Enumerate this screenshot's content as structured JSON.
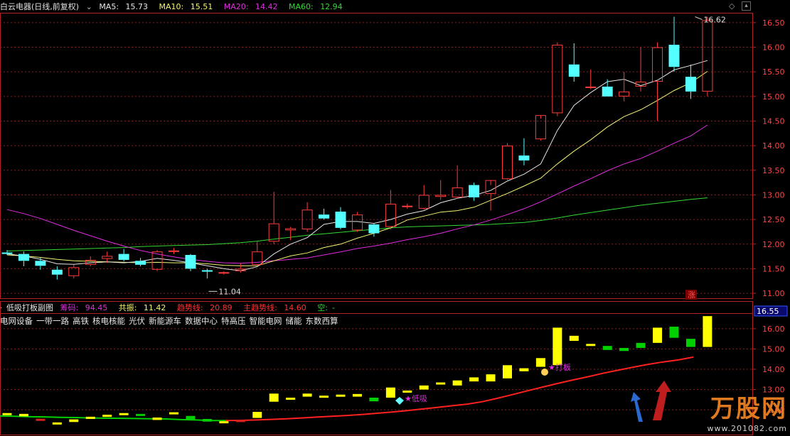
{
  "header": {
    "title": "白云电器(日线,前复权)",
    "ma5_label": "MA5: ",
    "ma5_value": "15.73",
    "ma10_label": "MA10: ",
    "ma10_value": "15.51",
    "ma20_label": "MA20: ",
    "ma20_value": "14.42",
    "ma60_label": "MA60: ",
    "ma60_value": "12.94"
  },
  "indicator": {
    "name": "低吸打板副图",
    "chip_label": "筹码: ",
    "chip_value": "94.45",
    "resonance_label": "共振: ",
    "resonance_value": "11.42",
    "trend_label": "趋势线: ",
    "trend_value": "20.89",
    "main_trend_label": "主趋势线: ",
    "main_trend_value": "14.60",
    "empty_label": "空:",
    "empty_value": "-"
  },
  "sectors": [
    "电网设备",
    "一带一路",
    "高铁",
    "核电核能",
    "光伏",
    "新能源车",
    "数据中心",
    "特高压",
    "智能电网",
    "储能",
    "东数西算"
  ],
  "watermark": {
    "brand": "万股网",
    "url": "www.201082.com"
  },
  "annotations": {
    "high_label": "16.62",
    "low_label": "11.04",
    "limit_up_badge": "涨",
    "dip_label": "低吸",
    "board_label": "打板",
    "current_price_tag": "16.55"
  },
  "colors": {
    "up": "#ff3c3c",
    "down": "#54ffff",
    "ma5": "#e6e6e6",
    "ma10": "#f4f473",
    "ma20": "#e02de0",
    "ma60": "#33d933",
    "grid": "#8a1f1f",
    "axis": "#b22222",
    "ind_bar": "#ffff00",
    "ind_green": "#00d000",
    "trend": "#ff2020"
  },
  "chart_data": [
    {
      "type": "candlestick",
      "title": "白云电器(日线,前复权)",
      "y_ticks_upper": [
        "16.50",
        "16.00",
        "15.50",
        "15.00",
        "14.50",
        "14.00",
        "13.50",
        "13.00",
        "12.50",
        "12.00",
        "11.50",
        "11.00"
      ],
      "ylim": [
        10.9,
        16.7
      ],
      "ohlc": [
        [
          11.83,
          11.88,
          11.78,
          11.8
        ],
        [
          11.8,
          11.85,
          11.55,
          11.66
        ],
        [
          11.66,
          11.72,
          11.48,
          11.56
        ],
        [
          11.48,
          11.55,
          11.28,
          11.38
        ],
        [
          11.35,
          11.58,
          11.3,
          11.53
        ],
        [
          11.58,
          11.75,
          11.55,
          11.68
        ],
        [
          11.7,
          11.85,
          11.62,
          11.76
        ],
        [
          11.8,
          11.9,
          11.65,
          11.68
        ],
        [
          11.66,
          11.72,
          11.55,
          11.58
        ],
        [
          11.48,
          11.88,
          11.45,
          11.85
        ],
        [
          11.85,
          11.92,
          11.8,
          11.87
        ],
        [
          11.78,
          11.8,
          11.45,
          11.5
        ],
        [
          11.47,
          11.5,
          11.3,
          11.44
        ],
        [
          11.42,
          11.45,
          11.38,
          11.43
        ],
        [
          11.45,
          11.62,
          11.42,
          11.5
        ],
        [
          11.58,
          12.05,
          11.55,
          11.85
        ],
        [
          12.05,
          13.06,
          12.0,
          12.42
        ],
        [
          12.28,
          12.35,
          12.08,
          12.32
        ],
        [
          12.3,
          12.85,
          12.25,
          12.7
        ],
        [
          12.6,
          12.72,
          12.5,
          12.52
        ],
        [
          12.66,
          12.75,
          12.3,
          12.33
        ],
        [
          12.28,
          12.65,
          12.25,
          12.6
        ],
        [
          12.4,
          12.42,
          12.15,
          12.22
        ],
        [
          12.35,
          13.1,
          12.3,
          12.82
        ],
        [
          12.78,
          12.82,
          12.72,
          12.78
        ],
        [
          12.72,
          13.2,
          12.7,
          13.0
        ],
        [
          12.96,
          13.3,
          12.9,
          13.0
        ],
        [
          12.95,
          13.6,
          12.92,
          13.15
        ],
        [
          13.2,
          13.25,
          12.88,
          12.95
        ],
        [
          13.02,
          13.2,
          12.68,
          13.3
        ],
        [
          13.32,
          14.05,
          13.3,
          14.0
        ],
        [
          13.8,
          14.15,
          13.6,
          13.7
        ],
        [
          14.13,
          14.55,
          14.1,
          14.62
        ],
        [
          14.66,
          16.1,
          14.6,
          16.05
        ],
        [
          15.65,
          16.08,
          15.3,
          15.4
        ],
        [
          15.2,
          15.55,
          15.15,
          15.2
        ],
        [
          15.2,
          15.35,
          15.0,
          15.0
        ],
        [
          15.0,
          15.5,
          14.9,
          15.1
        ],
        [
          15.2,
          16.0,
          15.1,
          15.3
        ],
        [
          15.3,
          16.1,
          14.5,
          16.0
        ],
        [
          16.05,
          16.62,
          15.5,
          15.6
        ],
        [
          15.4,
          15.65,
          14.95,
          15.1
        ],
        [
          15.1,
          16.62,
          15.0,
          16.55
        ]
      ],
      "ma5": [
        11.8,
        11.76,
        11.69,
        11.6,
        11.59,
        11.62,
        11.64,
        11.62,
        11.65,
        11.71,
        11.67,
        11.62,
        11.56,
        11.5,
        11.46,
        11.54,
        11.8,
        12.0,
        12.13,
        12.4,
        12.46,
        12.46,
        12.42,
        12.5,
        12.61,
        12.68,
        12.84,
        12.93,
        12.99,
        13.09,
        13.28,
        13.42,
        13.63,
        14.31,
        14.82,
        15.08,
        15.3,
        15.35,
        15.22,
        15.33,
        15.54,
        15.63,
        15.73
      ],
      "ma10": [
        11.78,
        11.76,
        11.73,
        11.69,
        11.66,
        11.65,
        11.64,
        11.63,
        11.62,
        11.63,
        11.62,
        11.62,
        11.6,
        11.57,
        11.56,
        11.56,
        11.66,
        11.76,
        11.82,
        11.93,
        12.0,
        12.12,
        12.22,
        12.33,
        12.49,
        12.57,
        12.65,
        12.68,
        12.75,
        12.89,
        13.03,
        13.18,
        13.34,
        13.63,
        13.89,
        14.12,
        14.38,
        14.59,
        14.73,
        14.92,
        15.12,
        15.28,
        15.51
      ],
      "ma20": [
        12.7,
        12.62,
        12.52,
        12.4,
        12.28,
        12.17,
        12.06,
        11.96,
        11.87,
        11.8,
        11.74,
        11.69,
        11.65,
        11.62,
        11.61,
        11.63,
        11.66,
        11.69,
        11.72,
        11.78,
        11.84,
        11.91,
        11.96,
        12.02,
        12.09,
        12.15,
        12.22,
        12.31,
        12.39,
        12.49,
        12.6,
        12.72,
        12.86,
        13.02,
        13.18,
        13.33,
        13.49,
        13.63,
        13.74,
        13.89,
        14.05,
        14.2,
        14.42
      ],
      "ma60": [
        11.86,
        11.87,
        11.88,
        11.89,
        11.9,
        11.91,
        11.92,
        11.93,
        11.95,
        11.96,
        11.97,
        11.98,
        11.99,
        12.01,
        12.03,
        12.06,
        12.1,
        12.14,
        12.18,
        12.21,
        12.24,
        12.27,
        12.3,
        12.33,
        12.35,
        12.36,
        12.37,
        12.38,
        12.39,
        12.4,
        12.42,
        12.44,
        12.48,
        12.53,
        12.59,
        12.64,
        12.69,
        12.74,
        12.79,
        12.83,
        12.87,
        12.91,
        12.94
      ]
    },
    {
      "type": "bar",
      "title": "低吸打板副图",
      "y_ticks_lower": [
        "16.00",
        "15.00",
        "14.00",
        "13.00",
        "12.00"
      ],
      "ylim": [
        11.2,
        16.8
      ],
      "bars": [
        [
          11.84,
          11.84,
          "y"
        ],
        [
          11.68,
          11.8,
          "y"
        ],
        [
          11.56,
          11.5,
          "r"
        ],
        [
          11.38,
          11.3,
          "y"
        ],
        [
          11.53,
          11.4,
          "y"
        ],
        [
          11.66,
          11.55,
          "y"
        ],
        [
          11.76,
          11.65,
          "y"
        ],
        [
          11.84,
          11.75,
          "y"
        ],
        [
          11.72,
          11.8,
          "g"
        ],
        [
          11.62,
          11.5,
          "y"
        ],
        [
          11.88,
          11.86,
          "y"
        ],
        [
          11.7,
          11.5,
          "g"
        ],
        [
          11.55,
          11.42,
          "g"
        ],
        [
          11.44,
          11.4,
          "y"
        ],
        [
          11.5,
          11.4,
          "r"
        ],
        [
          11.9,
          11.6,
          "y"
        ],
        [
          12.8,
          12.4,
          "y"
        ],
        [
          12.6,
          12.55,
          "y"
        ],
        [
          12.8,
          12.65,
          "y"
        ],
        [
          12.7,
          12.62,
          "y"
        ],
        [
          12.75,
          12.65,
          "y"
        ],
        [
          12.78,
          12.65,
          "y"
        ],
        [
          12.6,
          12.42,
          "g"
        ],
        [
          13.1,
          12.6,
          "y"
        ],
        [
          12.95,
          12.85,
          "y"
        ],
        [
          13.2,
          13.0,
          "y"
        ],
        [
          13.35,
          13.25,
          "y"
        ],
        [
          13.45,
          13.2,
          "y"
        ],
        [
          13.6,
          13.4,
          "y"
        ],
        [
          13.75,
          13.4,
          "y"
        ],
        [
          14.2,
          13.55,
          "y"
        ],
        [
          14.05,
          13.9,
          "y"
        ],
        [
          14.55,
          14.12,
          "y"
        ],
        [
          16.05,
          14.2,
          "y"
        ],
        [
          15.65,
          15.4,
          "y"
        ],
        [
          15.25,
          15.2,
          "y"
        ],
        [
          15.15,
          14.95,
          "g"
        ],
        [
          15.05,
          14.9,
          "g"
        ],
        [
          15.3,
          15.05,
          "g"
        ],
        [
          16.05,
          15.3,
          "y"
        ],
        [
          16.1,
          15.55,
          "g"
        ],
        [
          15.5,
          15.1,
          "g"
        ],
        [
          16.62,
          15.1,
          "y"
        ]
      ],
      "trend_line": [
        11.7,
        11.68,
        11.66,
        11.65,
        11.63,
        11.62,
        11.6,
        11.59,
        11.58,
        11.57,
        11.56,
        11.55,
        11.52,
        11.5,
        11.47,
        11.47,
        11.48,
        11.5,
        11.53,
        11.56,
        11.6,
        11.64,
        11.68,
        11.72,
        11.77,
        11.83,
        11.89,
        11.96,
        12.04,
        12.12,
        12.2,
        12.28,
        12.4,
        12.57,
        12.75,
        12.94,
        13.12,
        13.3,
        13.47,
        13.63,
        13.8,
        13.95,
        14.1,
        14.24,
        14.36,
        14.46,
        14.6
      ]
    }
  ]
}
